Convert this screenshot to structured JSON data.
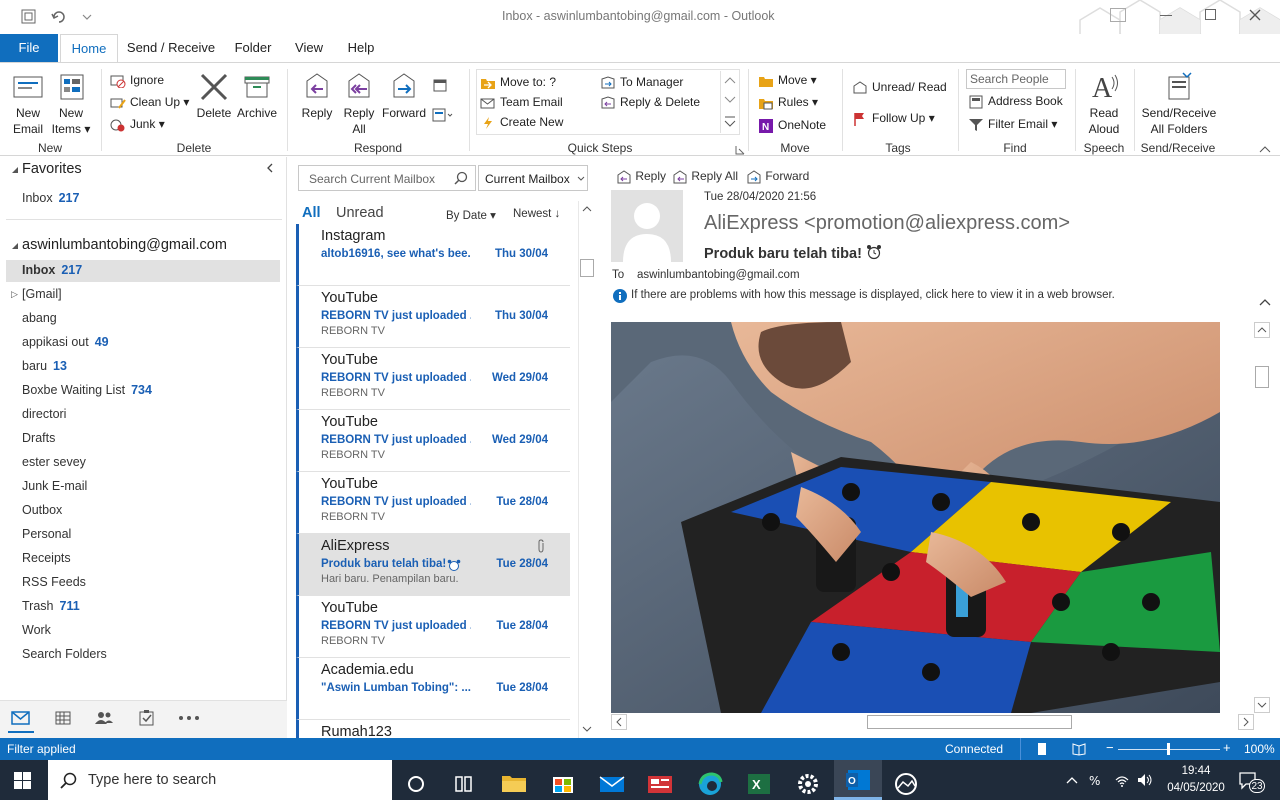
{
  "window": {
    "title": "Inbox - aswinlumbantobing@gmail.com  -  Outlook"
  },
  "tabs": [
    "File",
    "Home",
    "Send / Receive",
    "Folder",
    "View",
    "Help"
  ],
  "ribbon": {
    "new_email": "New Email",
    "new_email_l1": "New",
    "new_email_l2": "Email",
    "new_items_l1": "New",
    "new_items_l2": "Items",
    "group_new": "New",
    "ignore": "Ignore",
    "cleanup": "Clean Up",
    "junk": "Junk",
    "delete": "Delete",
    "archive": "Archive",
    "group_delete": "Delete",
    "reply": "Reply",
    "reply_all_l1": "Reply",
    "reply_all_l2": "All",
    "forward": "Forward",
    "group_respond": "Respond",
    "qs_moveto": "Move to: ?",
    "qs_team": "Team Email",
    "qs_create": "Create New",
    "qs_manager": "To Manager",
    "qs_replydel": "Reply & Delete",
    "group_quicksteps": "Quick Steps",
    "move": "Move",
    "rules": "Rules",
    "onenote": "OneNote",
    "group_move": "Move",
    "unread": "Unread/ Read",
    "followup": "Follow Up",
    "group_tags": "Tags",
    "search_people": "Search People",
    "address_book": "Address Book",
    "filter_email": "Filter Email",
    "group_find": "Find",
    "read_aloud_l1": "Read",
    "read_aloud_l2": "Aloud",
    "group_speech": "Speech",
    "sendrecv_l1": "Send/Receive",
    "sendrecv_l2": "All Folders",
    "group_sendrecv": "Send/Receive"
  },
  "folders": {
    "favorites_label": "Favorites",
    "fav_inbox": "Inbox",
    "fav_inbox_count": "217",
    "account": "aswinlumbantobing@gmail.com",
    "items": [
      {
        "name": "Inbox",
        "count": "217"
      },
      {
        "name": "[Gmail]",
        "count": ""
      },
      {
        "name": "abang",
        "count": ""
      },
      {
        "name": "appikasi out",
        "count": "49"
      },
      {
        "name": "baru",
        "count": "13"
      },
      {
        "name": "Boxbe Waiting List",
        "count": "734"
      },
      {
        "name": "directori",
        "count": ""
      },
      {
        "name": "Drafts",
        "count": ""
      },
      {
        "name": "ester sevey",
        "count": ""
      },
      {
        "name": "Junk E-mail",
        "count": ""
      },
      {
        "name": "Outbox",
        "count": ""
      },
      {
        "name": "Personal",
        "count": ""
      },
      {
        "name": "Receipts",
        "count": ""
      },
      {
        "name": "RSS Feeds",
        "count": ""
      },
      {
        "name": "Trash",
        "count": "711"
      },
      {
        "name": "Work",
        "count": ""
      },
      {
        "name": "Search Folders",
        "count": ""
      }
    ]
  },
  "list": {
    "search_placeholder": "Search Current Mailbox",
    "scope": "Current Mailbox",
    "filter_all": "All",
    "filter_unread": "Unread",
    "sort_by": "By Date",
    "sort_order": "Newest",
    "messages": [
      {
        "sender": "Instagram",
        "subject": "altob16916, see what's bee...",
        "date": "Thu 30/04",
        "preview": ""
      },
      {
        "sender": "YouTube",
        "subject": "REBORN TV just uploaded ...",
        "date": "Thu 30/04",
        "preview": "REBORN TV"
      },
      {
        "sender": "YouTube",
        "subject": "REBORN TV just uploaded ...",
        "date": "Wed 29/04",
        "preview": "REBORN TV"
      },
      {
        "sender": "YouTube",
        "subject": "REBORN TV just uploaded ...",
        "date": "Wed 29/04",
        "preview": "REBORN TV"
      },
      {
        "sender": "YouTube",
        "subject": "REBORN TV just uploaded ...",
        "date": "Tue 28/04",
        "preview": "REBORN TV"
      },
      {
        "sender": "AliExpress",
        "subject": "Produk baru telah tiba!",
        "date": "Tue 28/04",
        "preview": "Hari baru. Penampilan baru."
      },
      {
        "sender": "YouTube",
        "subject": "REBORN TV just uploaded ...",
        "date": "Tue 28/04",
        "preview": "REBORN TV"
      },
      {
        "sender": "Academia.edu",
        "subject": "\"Aswin Lumban Tobing\": ...",
        "date": "Tue 28/04",
        "preview": ""
      },
      {
        "sender": "Rumah123",
        "subject": "",
        "date": "",
        "preview": ""
      }
    ]
  },
  "reading": {
    "reply": "Reply",
    "reply_all": "Reply All",
    "forward": "Forward",
    "datetime": "Tue 28/04/2020 21:56",
    "from": "AliExpress <promotion@aliexpress.com>",
    "subject": "Produk baru telah tiba!",
    "to_label": "To",
    "to": "aswinlumbantobing@gmail.com",
    "info": "If there are problems with how this message is displayed, click here to view it in a web browser."
  },
  "status": {
    "left": "Filter applied",
    "connected": "Connected",
    "zoom": "100%"
  },
  "taskbar": {
    "search": "Type here to search",
    "time": "19:44",
    "date": "04/05/2020",
    "notif": "23"
  }
}
